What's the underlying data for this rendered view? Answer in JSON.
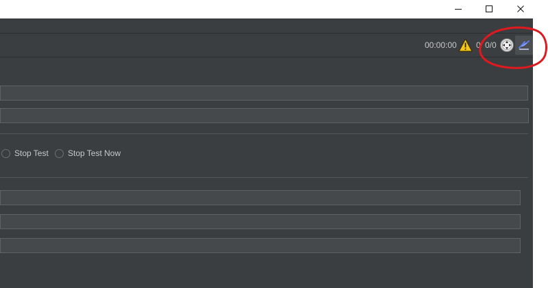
{
  "titlebar": {
    "minimize_icon": "minimize-icon",
    "maximize_icon": "maximize-icon",
    "close_icon": "close-icon"
  },
  "toolbar": {
    "elapsed_time": "00:00:00",
    "warning_icon": "warning-icon",
    "error_count": "0",
    "active_threads": "0/0",
    "remote_icon": "remote-start-icon",
    "log_icon": "log-viewer-icon"
  },
  "actions": {
    "stop_test": "Stop Test",
    "stop_test_now": "Stop Test Now"
  },
  "colors": {
    "app_bg": "#3b3e40",
    "field_bg": "#45494b",
    "annotation": "#e0191f",
    "warning": "#f5c518"
  }
}
